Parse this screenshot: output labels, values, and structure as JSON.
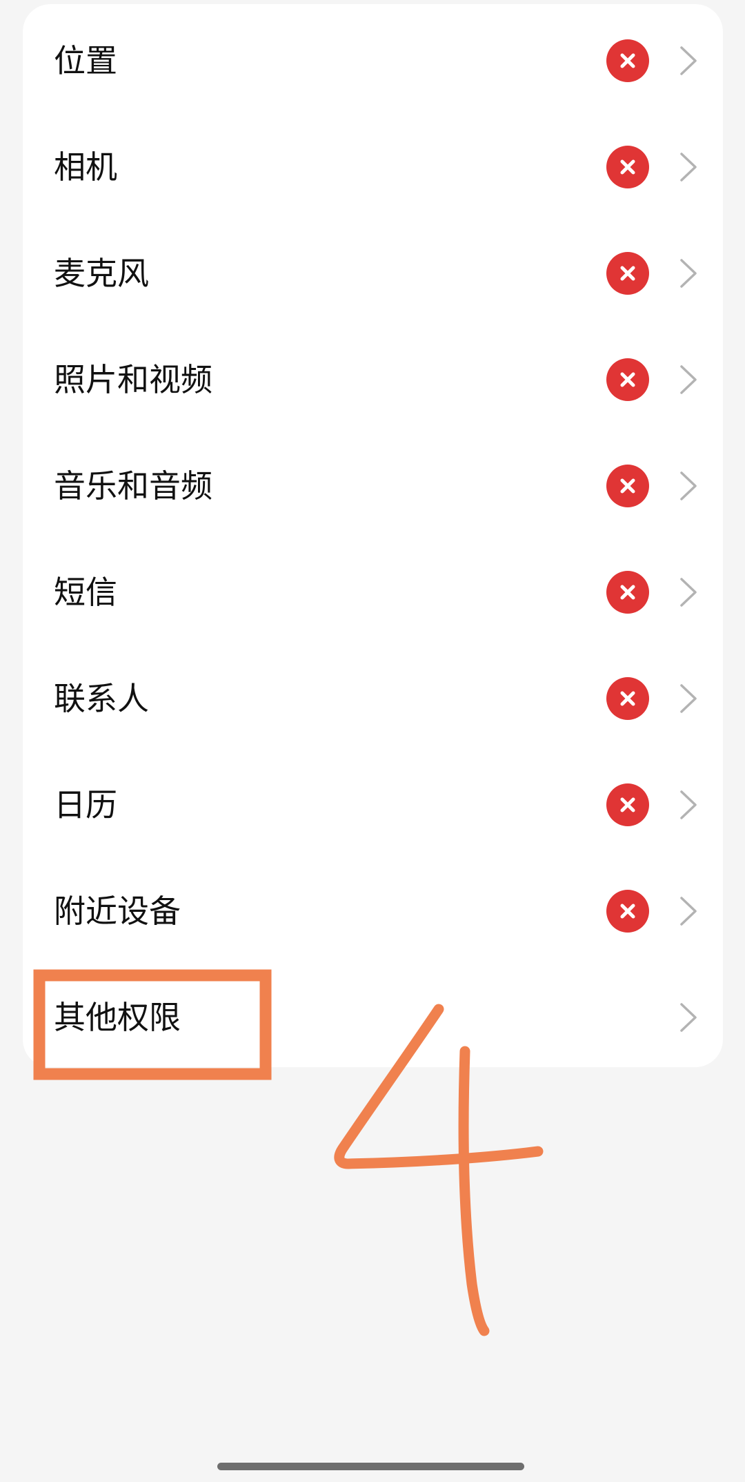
{
  "permissions": {
    "items": [
      {
        "label": "位置",
        "status": "denied"
      },
      {
        "label": "相机",
        "status": "denied"
      },
      {
        "label": "麦克风",
        "status": "denied"
      },
      {
        "label": "照片和视频",
        "status": "denied"
      },
      {
        "label": "音乐和音频",
        "status": "denied"
      },
      {
        "label": "短信",
        "status": "denied"
      },
      {
        "label": "联系人",
        "status": "denied"
      },
      {
        "label": "日历",
        "status": "denied"
      },
      {
        "label": "附近设备",
        "status": "denied"
      },
      {
        "label": "其他权限",
        "status": "none"
      }
    ]
  },
  "icons": {
    "status": "denied-x-icon",
    "row_arrow": "chevron-right-icon"
  },
  "colors": {
    "deny_icon": "#e03535",
    "chevron": "#b3b3b3",
    "annotation": "#f0814e",
    "background": "#f5f5f5",
    "card": "#ffffff"
  }
}
